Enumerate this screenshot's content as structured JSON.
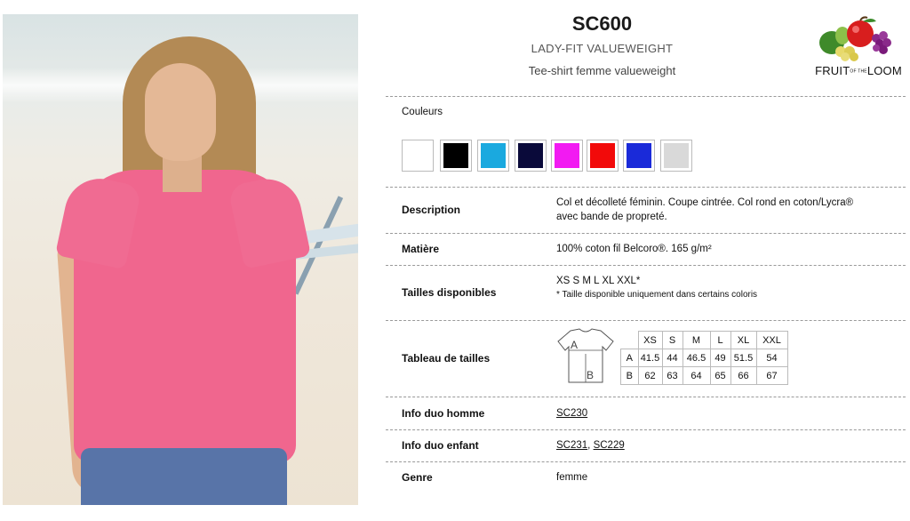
{
  "product": {
    "code": "SC600",
    "name": "LADY-FIT VALUEWEIGHT",
    "subtitle": "Tee-shirt femme valueweight"
  },
  "brand": {
    "logo_text_left": "FRUIT",
    "logo_text_mid": "OF THE",
    "logo_text_right": "LOOM"
  },
  "colors": {
    "label": "Couleurs",
    "swatches": [
      "#ffffff",
      "#000000",
      "#1aa9df",
      "#0a0a3a",
      "#f21af2",
      "#f20a0a",
      "#1a2ad9",
      "#d9d9d9"
    ]
  },
  "rows": {
    "description": {
      "label": "Description",
      "value_line1": "Col et décolleté féminin. Coupe cintrée. Col rond en coton/Lycra®",
      "value_line2": "avec bande de propreté."
    },
    "material": {
      "label": "Matière",
      "value": "100% coton fil Belcoro®. 165 g/m²"
    },
    "sizes": {
      "label": "Tailles disponibles",
      "value": "XS S M L XL XXL*",
      "note": "* Taille disponible uniquement dans certains coloris"
    },
    "size_chart": {
      "label": "Tableau de tailles",
      "diagram_a": "A",
      "diagram_b": "B",
      "headers": [
        "XS",
        "S",
        "M",
        "L",
        "XL",
        "XXL"
      ],
      "rows": [
        {
          "name": "A",
          "values": [
            "41.5",
            "44",
            "46.5",
            "49",
            "51.5",
            "54"
          ]
        },
        {
          "name": "B",
          "values": [
            "62",
            "63",
            "64",
            "65",
            "66",
            "67"
          ]
        }
      ]
    },
    "men": {
      "label": "Info duo homme",
      "link": "SC230"
    },
    "kids": {
      "label": "Info duo enfant",
      "link1": "SC231",
      "sep": ",",
      "link2": "SC229"
    },
    "gender": {
      "label": "Genre",
      "value": "femme"
    }
  }
}
